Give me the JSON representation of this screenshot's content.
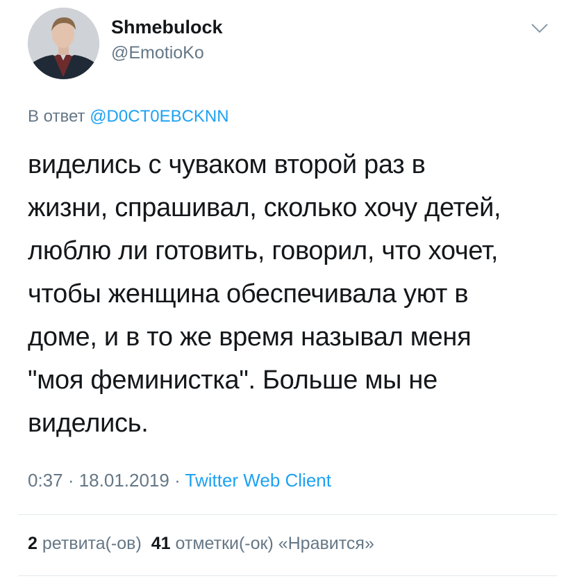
{
  "author": {
    "display_name": "Shmebulock",
    "handle": "@EmotioKo",
    "avatar_icon": "user-avatar"
  },
  "menu": {
    "icon": "chevron-down-icon"
  },
  "reply": {
    "prefix": "В ответ",
    "mention": "@D0CT0EBCKNN"
  },
  "tweet": {
    "lines": [
      "виделись с чуваком второй раз в",
      "жизни, спрашивал, сколько хочу детей,",
      "люблю ли готовить, говорил, что хочет,",
      "чтобы женщина обеспечивала уют в",
      "доме, и в то же время называл меня",
      "\"моя феминистка\". Больше мы не",
      "виделись."
    ]
  },
  "meta": {
    "time": "0:37",
    "separator": " · ",
    "date": "18.01.2019",
    "source": "Twitter Web Client"
  },
  "stats": {
    "retweets_count": "2",
    "retweets_label": "ретвита(-ов)",
    "likes_count": "41",
    "likes_label": "отметки(-ок) «Нравится»"
  },
  "colors": {
    "text": "#14171a",
    "secondary": "#657786",
    "link": "#1da1f2",
    "divider": "#e1e8ed"
  }
}
